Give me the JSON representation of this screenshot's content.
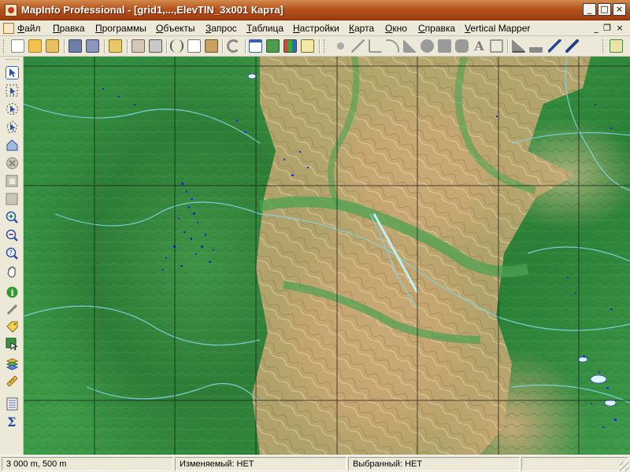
{
  "window": {
    "title": "MapInfo Professional - [grid1,...,ElevTIN_3x001 Карта]",
    "minimize_glyph": "_",
    "maximize_glyph": "□",
    "close_glyph": "×"
  },
  "menu": {
    "items": [
      "Файл",
      "Правка",
      "Программы",
      "Объекты",
      "Запрос",
      "Таблица",
      "Настройки",
      "Карта",
      "Окно",
      "Справка",
      "Vertical Mapper"
    ],
    "mdi_minimize": "_",
    "mdi_restore": "❐",
    "mdi_close": "×"
  },
  "toolbar": {
    "icons": [
      "new-icon",
      "open-icon",
      "open-workspace-icon",
      "save-icon",
      "save-copy-icon",
      "open-dbms-icon",
      "new-map-window-icon",
      "print-icon",
      "cut-icon",
      "copy-icon",
      "paste-icon",
      "undo-icon",
      "new-browser-icon",
      "new-mapper-icon",
      "new-graph-icon",
      "new-layout-icon",
      "symbol-icon",
      "line-icon",
      "polyline-icon",
      "arc-icon",
      "polygon-icon",
      "ellipse-icon",
      "rectangle-icon",
      "rounded-rectangle-icon",
      "text-icon",
      "frame-icon",
      "reshape-icon",
      "add-node-icon",
      "help-pointer-icon",
      "vertical-mapper-icon"
    ]
  },
  "left_tools": {
    "icons": [
      "select-arrow-icon",
      "marquee-select-icon",
      "radius-select-icon",
      "polygon-select-icon",
      "boundary-select-icon",
      "unselect-icon",
      "invert-select-icon",
      "graph-select-icon",
      "zoom-in-icon",
      "zoom-out-icon",
      "change-view-icon",
      "grabber-hand-icon",
      "info-icon",
      "ruler-icon",
      "label-icon",
      "drag-map-icon",
      "layer-control-icon",
      "scale-bar-icon",
      "statistics-icon",
      "sum-icon"
    ]
  },
  "colors": {
    "title_bar": "#b5541e",
    "chrome": "#ece9d8",
    "map_forest": "#2f8a3d",
    "map_mountain": "#c8a874",
    "map_river": "#7fd8e6",
    "map_lakes": "#1a2bd6",
    "grid_line": "#1a1a1a"
  },
  "status": {
    "scale": "3 000 m, 500 m",
    "editable": "Изменяемый: НЕТ",
    "selected": "Выбранный: НЕТ"
  }
}
